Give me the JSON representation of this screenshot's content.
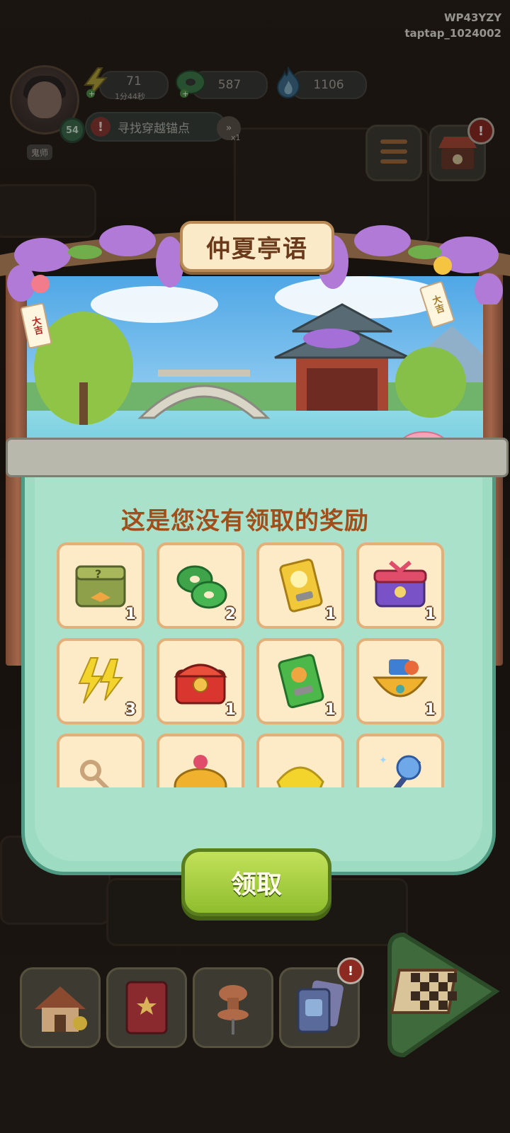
{
  "watermark": {
    "line1": "WP43YZY",
    "line2": "taptap_1024002"
  },
  "hud": {
    "level": "54",
    "avatar_tag": "鬼师",
    "energy": {
      "value": "71",
      "timer": "1分44秒",
      "icon": "lightning-icon"
    },
    "jade": {
      "value": "587",
      "icon": "jade-coin-icon"
    },
    "flame": {
      "value": "1106",
      "icon": "blue-flame-icon"
    },
    "quest": {
      "label": "寻找穿越锚点",
      "count": "x1"
    }
  },
  "dialog": {
    "title": "仲夏亭语",
    "tags": [
      "大吉",
      "大吉"
    ],
    "subtitle": "这是您没有领取的奖励",
    "claim_label": "领取"
  },
  "rewards": [
    {
      "icon": "mystery-box-icon",
      "qty": "1"
    },
    {
      "icon": "jade-coins-icon",
      "qty": "2"
    },
    {
      "icon": "gold-ticket-icon",
      "qty": "1"
    },
    {
      "icon": "purple-gift-chest-icon",
      "qty": "1"
    },
    {
      "icon": "gold-lightning-icon",
      "qty": "3"
    },
    {
      "icon": "red-treasure-chest-icon",
      "qty": "1"
    },
    {
      "icon": "green-ticket-icon",
      "qty": "1"
    },
    {
      "icon": "treasure-bowl-icon",
      "qty": "1"
    },
    {
      "icon": "key-icon",
      "qty": ""
    },
    {
      "icon": "gold-bag-icon",
      "qty": ""
    },
    {
      "icon": "gold-ingot-icon",
      "qty": ""
    },
    {
      "icon": "blue-wand-icon",
      "qty": ""
    }
  ],
  "nav": {
    "home": "house-icon",
    "book": "book-icon",
    "pin": "pushpin-icon",
    "cards": "cards-icon",
    "go": "chessboard-icon"
  },
  "colors": {
    "panel": "#a9e1cb",
    "title": "#a14e1a",
    "claim": "#8fbd2e",
    "slot": "#fcebc6"
  }
}
